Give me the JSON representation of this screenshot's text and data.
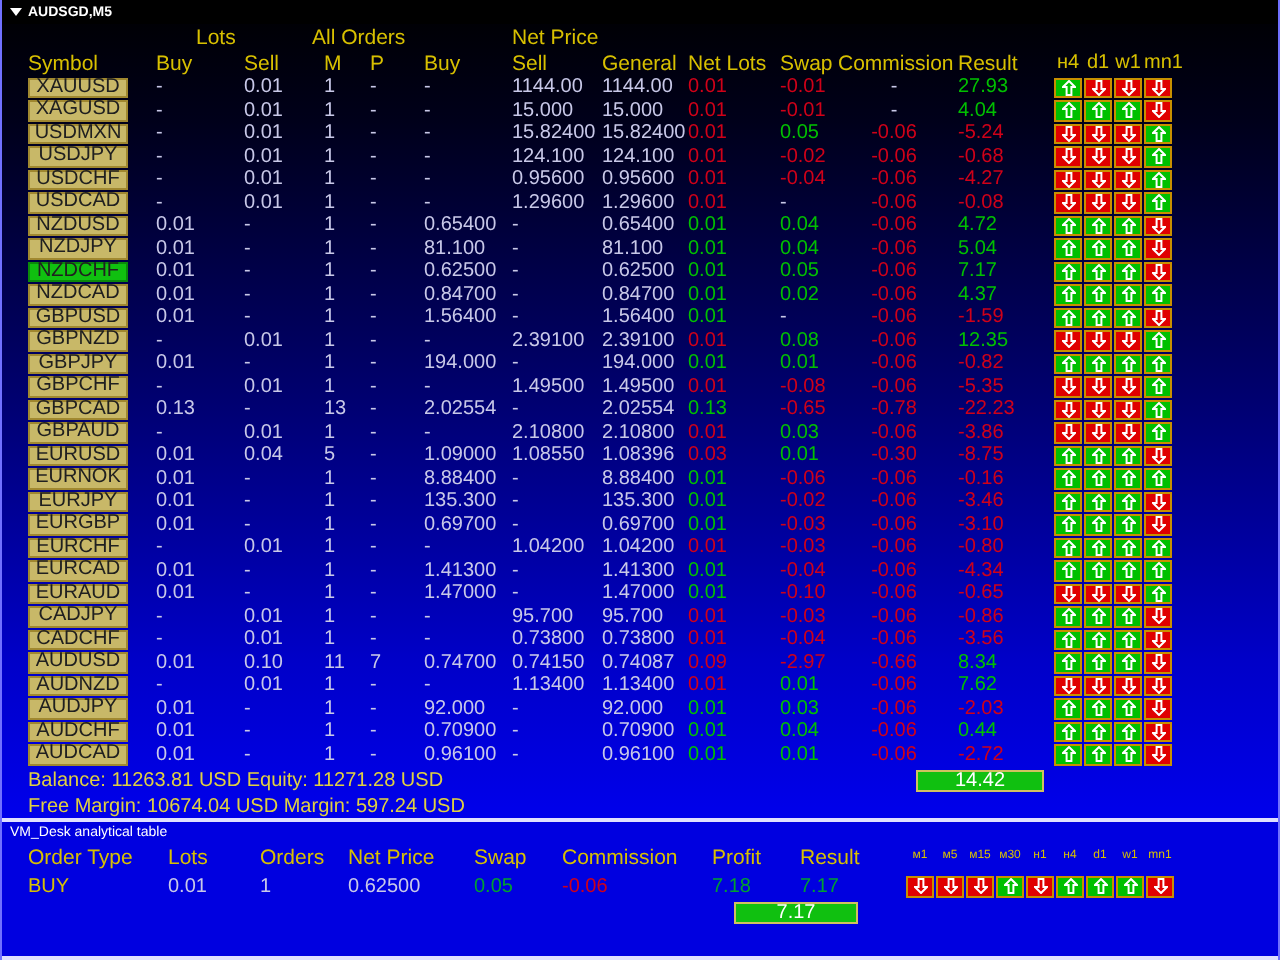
{
  "chart_title": "AUDSGD,M5",
  "group_headers": [
    "Lots",
    "All Orders",
    "Net Price"
  ],
  "columns": [
    "Symbol",
    "Buy",
    "Sell",
    "M",
    "P",
    "Buy",
    "Sell",
    "General",
    "Net Lots",
    "Swap",
    "Commission",
    "Result"
  ],
  "timeframes": [
    "н4",
    "d1",
    "w1",
    "mn1"
  ],
  "rows": [
    {
      "symbol": "XAUUSD",
      "selected": false,
      "buy_lots": "-",
      "sell_lots": "0.01",
      "m": "1",
      "p": "-",
      "buy_price": "-",
      "sell_price": "1144.00",
      "general": "1144.00",
      "net_lots": {
        "text": "0.01",
        "color": "#d00018"
      },
      "swap": {
        "text": "-0.01",
        "color": "#d00018"
      },
      "commission": {
        "text": "-",
        "color": "#c8c8e8"
      },
      "result": {
        "text": "27.93",
        "color": "#00c000"
      },
      "signals": [
        {
          "kind": "up"
        },
        {
          "kind": "down"
        },
        {
          "kind": "down"
        },
        {
          "kind": "down"
        }
      ]
    },
    {
      "symbol": "XAGUSD",
      "selected": false,
      "buy_lots": "-",
      "sell_lots": "0.01",
      "m": "1",
      "p": "-",
      "buy_price": "-",
      "sell_price": "15.000",
      "general": "15.000",
      "net_lots": {
        "text": "0.01",
        "color": "#d00018"
      },
      "swap": {
        "text": "-0.01",
        "color": "#d00018"
      },
      "commission": {
        "text": "-",
        "color": "#c8c8e8"
      },
      "result": {
        "text": "4.04",
        "color": "#00c000"
      },
      "signals": [
        {
          "kind": "up"
        },
        {
          "kind": "up"
        },
        {
          "kind": "up"
        },
        {
          "kind": "down"
        }
      ]
    },
    {
      "symbol": "USDMXN",
      "selected": false,
      "buy_lots": "-",
      "sell_lots": "0.01",
      "m": "1",
      "p": "-",
      "buy_price": "-",
      "sell_price": "15.82400",
      "general": "15.82400",
      "net_lots": {
        "text": "0.01",
        "color": "#d00018"
      },
      "swap": {
        "text": "0.05",
        "color": "#00c000"
      },
      "commission": {
        "text": "-0.06",
        "color": "#d00018"
      },
      "result": {
        "text": "-5.24",
        "color": "#d00018"
      },
      "signals": [
        {
          "kind": "down"
        },
        {
          "kind": "down"
        },
        {
          "kind": "down"
        },
        {
          "kind": "up"
        }
      ]
    },
    {
      "symbol": "USDJPY",
      "selected": false,
      "buy_lots": "-",
      "sell_lots": "0.01",
      "m": "1",
      "p": "-",
      "buy_price": "-",
      "sell_price": "124.100",
      "general": "124.100",
      "net_lots": {
        "text": "0.01",
        "color": "#d00018"
      },
      "swap": {
        "text": "-0.02",
        "color": "#d00018"
      },
      "commission": {
        "text": "-0.06",
        "color": "#d00018"
      },
      "result": {
        "text": "-0.68",
        "color": "#d00018"
      },
      "signals": [
        {
          "kind": "down"
        },
        {
          "kind": "down"
        },
        {
          "kind": "down"
        },
        {
          "kind": "up"
        }
      ]
    },
    {
      "symbol": "USDCHF",
      "selected": false,
      "buy_lots": "-",
      "sell_lots": "0.01",
      "m": "1",
      "p": "-",
      "buy_price": "-",
      "sell_price": "0.95600",
      "general": "0.95600",
      "net_lots": {
        "text": "0.01",
        "color": "#d00018"
      },
      "swap": {
        "text": "-0.04",
        "color": "#d00018"
      },
      "commission": {
        "text": "-0.06",
        "color": "#d00018"
      },
      "result": {
        "text": "-4.27",
        "color": "#d00018"
      },
      "signals": [
        {
          "kind": "down"
        },
        {
          "kind": "down"
        },
        {
          "kind": "down"
        },
        {
          "kind": "up"
        }
      ]
    },
    {
      "symbol": "USDCAD",
      "selected": false,
      "buy_lots": "-",
      "sell_lots": "0.01",
      "m": "1",
      "p": "-",
      "buy_price": "-",
      "sell_price": "1.29600",
      "general": "1.29600",
      "net_lots": {
        "text": "0.01",
        "color": "#d00018"
      },
      "swap": {
        "text": "-",
        "color": "#c8c8e8"
      },
      "commission": {
        "text": "-0.06",
        "color": "#d00018"
      },
      "result": {
        "text": "-0.08",
        "color": "#d00018"
      },
      "signals": [
        {
          "kind": "down"
        },
        {
          "kind": "down"
        },
        {
          "kind": "down"
        },
        {
          "kind": "up"
        }
      ]
    },
    {
      "symbol": "NZDUSD",
      "selected": false,
      "buy_lots": "0.01",
      "sell_lots": "-",
      "m": "1",
      "p": "-",
      "buy_price": "0.65400",
      "sell_price": "-",
      "general": "0.65400",
      "net_lots": {
        "text": "0.01",
        "color": "#00c000"
      },
      "swap": {
        "text": "0.04",
        "color": "#00c000"
      },
      "commission": {
        "text": "-0.06",
        "color": "#d00018"
      },
      "result": {
        "text": "4.72",
        "color": "#00c000"
      },
      "signals": [
        {
          "kind": "up"
        },
        {
          "kind": "up"
        },
        {
          "kind": "up"
        },
        {
          "kind": "down"
        }
      ]
    },
    {
      "symbol": "NZDJPY",
      "selected": false,
      "buy_lots": "0.01",
      "sell_lots": "-",
      "m": "1",
      "p": "-",
      "buy_price": "81.100",
      "sell_price": "-",
      "general": "81.100",
      "net_lots": {
        "text": "0.01",
        "color": "#00c000"
      },
      "swap": {
        "text": "0.04",
        "color": "#00c000"
      },
      "commission": {
        "text": "-0.06",
        "color": "#d00018"
      },
      "result": {
        "text": "5.04",
        "color": "#00c000"
      },
      "signals": [
        {
          "kind": "up"
        },
        {
          "kind": "up"
        },
        {
          "kind": "up"
        },
        {
          "kind": "down"
        }
      ]
    },
    {
      "symbol": "NZDCHF",
      "selected": true,
      "buy_lots": "0.01",
      "sell_lots": "-",
      "m": "1",
      "p": "-",
      "buy_price": "0.62500",
      "sell_price": "-",
      "general": "0.62500",
      "net_lots": {
        "text": "0.01",
        "color": "#00c000"
      },
      "swap": {
        "text": "0.05",
        "color": "#00c000"
      },
      "commission": {
        "text": "-0.06",
        "color": "#d00018"
      },
      "result": {
        "text": "7.17",
        "color": "#00c000"
      },
      "signals": [
        {
          "kind": "up"
        },
        {
          "kind": "up"
        },
        {
          "kind": "up"
        },
        {
          "kind": "down"
        }
      ]
    },
    {
      "symbol": "NZDCAD",
      "selected": false,
      "buy_lots": "0.01",
      "sell_lots": "-",
      "m": "1",
      "p": "-",
      "buy_price": "0.84700",
      "sell_price": "-",
      "general": "0.84700",
      "net_lots": {
        "text": "0.01",
        "color": "#00c000"
      },
      "swap": {
        "text": "0.02",
        "color": "#00c000"
      },
      "commission": {
        "text": "-0.06",
        "color": "#d00018"
      },
      "result": {
        "text": "4.37",
        "color": "#00c000"
      },
      "signals": [
        {
          "kind": "up"
        },
        {
          "kind": "up"
        },
        {
          "kind": "up"
        },
        {
          "kind": "up"
        }
      ]
    },
    {
      "symbol": "GBPUSD",
      "selected": false,
      "buy_lots": "0.01",
      "sell_lots": "-",
      "m": "1",
      "p": "-",
      "buy_price": "1.56400",
      "sell_price": "-",
      "general": "1.56400",
      "net_lots": {
        "text": "0.01",
        "color": "#00c000"
      },
      "swap": {
        "text": "-",
        "color": "#c8c8e8"
      },
      "commission": {
        "text": "-0.06",
        "color": "#d00018"
      },
      "result": {
        "text": "-1.59",
        "color": "#d00018"
      },
      "signals": [
        {
          "kind": "up"
        },
        {
          "kind": "up"
        },
        {
          "kind": "up"
        },
        {
          "kind": "down"
        }
      ]
    },
    {
      "symbol": "GBPNZD",
      "selected": false,
      "buy_lots": "-",
      "sell_lots": "0.01",
      "m": "1",
      "p": "-",
      "buy_price": "-",
      "sell_price": "2.39100",
      "general": "2.39100",
      "net_lots": {
        "text": "0.01",
        "color": "#d00018"
      },
      "swap": {
        "text": "0.08",
        "color": "#00c000"
      },
      "commission": {
        "text": "-0.06",
        "color": "#d00018"
      },
      "result": {
        "text": "12.35",
        "color": "#00c000"
      },
      "signals": [
        {
          "kind": "down"
        },
        {
          "kind": "down"
        },
        {
          "kind": "down"
        },
        {
          "kind": "up"
        }
      ]
    },
    {
      "symbol": "GBPJPY",
      "selected": false,
      "buy_lots": "0.01",
      "sell_lots": "-",
      "m": "1",
      "p": "-",
      "buy_price": "194.000",
      "sell_price": "-",
      "general": "194.000",
      "net_lots": {
        "text": "0.01",
        "color": "#00c000"
      },
      "swap": {
        "text": "0.01",
        "color": "#00c000"
      },
      "commission": {
        "text": "-0.06",
        "color": "#d00018"
      },
      "result": {
        "text": "-0.82",
        "color": "#d00018"
      },
      "signals": [
        {
          "kind": "up"
        },
        {
          "kind": "up"
        },
        {
          "kind": "up"
        },
        {
          "kind": "up"
        }
      ]
    },
    {
      "symbol": "GBPCHF",
      "selected": false,
      "buy_lots": "-",
      "sell_lots": "0.01",
      "m": "1",
      "p": "-",
      "buy_price": "-",
      "sell_price": "1.49500",
      "general": "1.49500",
      "net_lots": {
        "text": "0.01",
        "color": "#d00018"
      },
      "swap": {
        "text": "-0.08",
        "color": "#d00018"
      },
      "commission": {
        "text": "-0.06",
        "color": "#d00018"
      },
      "result": {
        "text": "-5.35",
        "color": "#d00018"
      },
      "signals": [
        {
          "kind": "down"
        },
        {
          "kind": "down"
        },
        {
          "kind": "down"
        },
        {
          "kind": "up"
        }
      ]
    },
    {
      "symbol": "GBPCAD",
      "selected": false,
      "buy_lots": "0.13",
      "sell_lots": "-",
      "m": "13",
      "p": "-",
      "buy_price": "2.02554",
      "sell_price": "-",
      "general": "2.02554",
      "net_lots": {
        "text": "0.13",
        "color": "#00c000"
      },
      "swap": {
        "text": "-0.65",
        "color": "#d00018"
      },
      "commission": {
        "text": "-0.78",
        "color": "#d00018"
      },
      "result": {
        "text": "-22.23",
        "color": "#d00018"
      },
      "signals": [
        {
          "kind": "down"
        },
        {
          "kind": "down"
        },
        {
          "kind": "down"
        },
        {
          "kind": "up"
        }
      ]
    },
    {
      "symbol": "GBPAUD",
      "selected": false,
      "buy_lots": "-",
      "sell_lots": "0.01",
      "m": "1",
      "p": "-",
      "buy_price": "-",
      "sell_price": "2.10800",
      "general": "2.10800",
      "net_lots": {
        "text": "0.01",
        "color": "#d00018"
      },
      "swap": {
        "text": "0.03",
        "color": "#00c000"
      },
      "commission": {
        "text": "-0.06",
        "color": "#d00018"
      },
      "result": {
        "text": "-3.86",
        "color": "#d00018"
      },
      "signals": [
        {
          "kind": "down"
        },
        {
          "kind": "down"
        },
        {
          "kind": "down"
        },
        {
          "kind": "up"
        }
      ]
    },
    {
      "symbol": "EURUSD",
      "selected": false,
      "buy_lots": "0.01",
      "sell_lots": "0.04",
      "m": "5",
      "p": "-",
      "buy_price": "1.09000",
      "sell_price": "1.08550",
      "general": "1.08396",
      "net_lots": {
        "text": "0.03",
        "color": "#d00018"
      },
      "swap": {
        "text": "0.01",
        "color": "#00c000"
      },
      "commission": {
        "text": "-0.30",
        "color": "#d00018"
      },
      "result": {
        "text": "-8.75",
        "color": "#d00018"
      },
      "signals": [
        {
          "kind": "up"
        },
        {
          "kind": "up"
        },
        {
          "kind": "up"
        },
        {
          "kind": "down"
        }
      ]
    },
    {
      "symbol": "EURNOK",
      "selected": false,
      "buy_lots": "0.01",
      "sell_lots": "-",
      "m": "1",
      "p": "-",
      "buy_price": "8.88400",
      "sell_price": "-",
      "general": "8.88400",
      "net_lots": {
        "text": "0.01",
        "color": "#00c000"
      },
      "swap": {
        "text": "-0.06",
        "color": "#d00018"
      },
      "commission": {
        "text": "-0.06",
        "color": "#d00018"
      },
      "result": {
        "text": "-0.16",
        "color": "#d00018"
      },
      "signals": [
        {
          "kind": "up"
        },
        {
          "kind": "up"
        },
        {
          "kind": "up"
        },
        {
          "kind": "up"
        }
      ]
    },
    {
      "symbol": "EURJPY",
      "selected": false,
      "buy_lots": "0.01",
      "sell_lots": "-",
      "m": "1",
      "p": "-",
      "buy_price": "135.300",
      "sell_price": "-",
      "general": "135.300",
      "net_lots": {
        "text": "0.01",
        "color": "#00c000"
      },
      "swap": {
        "text": "-0.02",
        "color": "#d00018"
      },
      "commission": {
        "text": "-0.06",
        "color": "#d00018"
      },
      "result": {
        "text": "-3.46",
        "color": "#d00018"
      },
      "signals": [
        {
          "kind": "up"
        },
        {
          "kind": "up"
        },
        {
          "kind": "up"
        },
        {
          "kind": "down"
        }
      ]
    },
    {
      "symbol": "EURGBP",
      "selected": false,
      "buy_lots": "0.01",
      "sell_lots": "-",
      "m": "1",
      "p": "-",
      "buy_price": "0.69700",
      "sell_price": "-",
      "general": "0.69700",
      "net_lots": {
        "text": "0.01",
        "color": "#00c000"
      },
      "swap": {
        "text": "-0.03",
        "color": "#d00018"
      },
      "commission": {
        "text": "-0.06",
        "color": "#d00018"
      },
      "result": {
        "text": "-3.10",
        "color": "#d00018"
      },
      "signals": [
        {
          "kind": "up"
        },
        {
          "kind": "up"
        },
        {
          "kind": "up"
        },
        {
          "kind": "down"
        }
      ]
    },
    {
      "symbol": "EURCHF",
      "selected": false,
      "buy_lots": "-",
      "sell_lots": "0.01",
      "m": "1",
      "p": "-",
      "buy_price": "-",
      "sell_price": "1.04200",
      "general": "1.04200",
      "net_lots": {
        "text": "0.01",
        "color": "#d00018"
      },
      "swap": {
        "text": "-0.03",
        "color": "#d00018"
      },
      "commission": {
        "text": "-0.06",
        "color": "#d00018"
      },
      "result": {
        "text": "-0.80",
        "color": "#d00018"
      },
      "signals": [
        {
          "kind": "up"
        },
        {
          "kind": "up"
        },
        {
          "kind": "up"
        },
        {
          "kind": "up"
        }
      ]
    },
    {
      "symbol": "EURCAD",
      "selected": false,
      "buy_lots": "0.01",
      "sell_lots": "-",
      "m": "1",
      "p": "-",
      "buy_price": "1.41300",
      "sell_price": "-",
      "general": "1.41300",
      "net_lots": {
        "text": "0.01",
        "color": "#00c000"
      },
      "swap": {
        "text": "-0.04",
        "color": "#d00018"
      },
      "commission": {
        "text": "-0.06",
        "color": "#d00018"
      },
      "result": {
        "text": "-4.34",
        "color": "#d00018"
      },
      "signals": [
        {
          "kind": "up"
        },
        {
          "kind": "up"
        },
        {
          "kind": "up"
        },
        {
          "kind": "up"
        }
      ]
    },
    {
      "symbol": "EURAUD",
      "selected": false,
      "buy_lots": "0.01",
      "sell_lots": "-",
      "m": "1",
      "p": "-",
      "buy_price": "1.47000",
      "sell_price": "-",
      "general": "1.47000",
      "net_lots": {
        "text": "0.01",
        "color": "#00c000"
      },
      "swap": {
        "text": "-0.10",
        "color": "#d00018"
      },
      "commission": {
        "text": "-0.06",
        "color": "#d00018"
      },
      "result": {
        "text": "-0.65",
        "color": "#d00018"
      },
      "signals": [
        {
          "kind": "down"
        },
        {
          "kind": "down"
        },
        {
          "kind": "down"
        },
        {
          "kind": "up"
        }
      ]
    },
    {
      "symbol": "CADJPY",
      "selected": false,
      "buy_lots": "-",
      "sell_lots": "0.01",
      "m": "1",
      "p": "-",
      "buy_price": "-",
      "sell_price": "95.700",
      "general": "95.700",
      "net_lots": {
        "text": "0.01",
        "color": "#d00018"
      },
      "swap": {
        "text": "-0.03",
        "color": "#d00018"
      },
      "commission": {
        "text": "-0.06",
        "color": "#d00018"
      },
      "result": {
        "text": "-0.86",
        "color": "#d00018"
      },
      "signals": [
        {
          "kind": "up"
        },
        {
          "kind": "up"
        },
        {
          "kind": "up"
        },
        {
          "kind": "down"
        }
      ]
    },
    {
      "symbol": "CADCHF",
      "selected": false,
      "buy_lots": "-",
      "sell_lots": "0.01",
      "m": "1",
      "p": "-",
      "buy_price": "-",
      "sell_price": "0.73800",
      "general": "0.73800",
      "net_lots": {
        "text": "0.01",
        "color": "#d00018"
      },
      "swap": {
        "text": "-0.04",
        "color": "#d00018"
      },
      "commission": {
        "text": "-0.06",
        "color": "#d00018"
      },
      "result": {
        "text": "-3.56",
        "color": "#d00018"
      },
      "signals": [
        {
          "kind": "up"
        },
        {
          "kind": "up"
        },
        {
          "kind": "up"
        },
        {
          "kind": "down"
        }
      ]
    },
    {
      "symbol": "AUDUSD",
      "selected": false,
      "buy_lots": "0.01",
      "sell_lots": "0.10",
      "m": "11",
      "p": "7",
      "buy_price": "0.74700",
      "sell_price": "0.74150",
      "general": "0.74087",
      "net_lots": {
        "text": "0.09",
        "color": "#d00018"
      },
      "swap": {
        "text": "-2.97",
        "color": "#d00018"
      },
      "commission": {
        "text": "-0.66",
        "color": "#d00018"
      },
      "result": {
        "text": "8.34",
        "color": "#00c000"
      },
      "signals": [
        {
          "kind": "up"
        },
        {
          "kind": "up"
        },
        {
          "kind": "up"
        },
        {
          "kind": "down"
        }
      ]
    },
    {
      "symbol": "AUDNZD",
      "selected": false,
      "buy_lots": "-",
      "sell_lots": "0.01",
      "m": "1",
      "p": "-",
      "buy_price": "-",
      "sell_price": "1.13400",
      "general": "1.13400",
      "net_lots": {
        "text": "0.01",
        "color": "#d00018"
      },
      "swap": {
        "text": "0.01",
        "color": "#00c000"
      },
      "commission": {
        "text": "-0.06",
        "color": "#d00018"
      },
      "result": {
        "text": "7.62",
        "color": "#00c000"
      },
      "signals": [
        {
          "kind": "down"
        },
        {
          "kind": "down"
        },
        {
          "kind": "down"
        },
        {
          "kind": "down"
        }
      ]
    },
    {
      "symbol": "AUDJPY",
      "selected": false,
      "buy_lots": "0.01",
      "sell_lots": "-",
      "m": "1",
      "p": "-",
      "buy_price": "92.000",
      "sell_price": "-",
      "general": "92.000",
      "net_lots": {
        "text": "0.01",
        "color": "#00c000"
      },
      "swap": {
        "text": "0.03",
        "color": "#00c000"
      },
      "commission": {
        "text": "-0.06",
        "color": "#d00018"
      },
      "result": {
        "text": "-2.03",
        "color": "#d00018"
      },
      "signals": [
        {
          "kind": "up"
        },
        {
          "kind": "up"
        },
        {
          "kind": "up"
        },
        {
          "kind": "down"
        }
      ]
    },
    {
      "symbol": "AUDCHF",
      "selected": false,
      "buy_lots": "0.01",
      "sell_lots": "-",
      "m": "1",
      "p": "-",
      "buy_price": "0.70900",
      "sell_price": "-",
      "general": "0.70900",
      "net_lots": {
        "text": "0.01",
        "color": "#00c000"
      },
      "swap": {
        "text": "0.04",
        "color": "#00c000"
      },
      "commission": {
        "text": "-0.06",
        "color": "#d00018"
      },
      "result": {
        "text": "0.44",
        "color": "#00c000"
      },
      "signals": [
        {
          "kind": "up"
        },
        {
          "kind": "up"
        },
        {
          "kind": "up"
        },
        {
          "kind": "down"
        }
      ]
    },
    {
      "symbol": "AUDCAD",
      "selected": false,
      "buy_lots": "0.01",
      "sell_lots": "-",
      "m": "1",
      "p": "-",
      "buy_price": "0.96100",
      "sell_price": "-",
      "general": "0.96100",
      "net_lots": {
        "text": "0.01",
        "color": "#00c000"
      },
      "swap": {
        "text": "0.01",
        "color": "#00c000"
      },
      "commission": {
        "text": "-0.06",
        "color": "#d00018"
      },
      "result": {
        "text": "-2.72",
        "color": "#d00018"
      },
      "signals": [
        {
          "kind": "up"
        },
        {
          "kind": "up"
        },
        {
          "kind": "up"
        },
        {
          "kind": "down"
        }
      ]
    }
  ],
  "account": {
    "lines": [
      "Balance: 11263.81 USD Equity: 11271.28 USD",
      "Free Margin: 10674.04 USD Margin: 597.24 USD"
    ],
    "total": "14.42"
  },
  "analytics": {
    "title": "VM_Desk analytical table",
    "columns": [
      "Order Type",
      "Lots",
      "Orders",
      "Net Price",
      "Swap",
      "Commission",
      "Profit",
      "Result"
    ],
    "row": {
      "order_type": "BUY",
      "lots": "0.01",
      "orders": "1",
      "net_price": "0.62500",
      "swap": {
        "text": "0.05",
        "color": "#00a030"
      },
      "commission": {
        "text": "-0.06",
        "color": "#d00018"
      },
      "profit": {
        "text": "7.18",
        "color": "#00a030"
      },
      "result": {
        "text": "7.17",
        "color": "#00a030"
      }
    },
    "timeframes": [
      "м1",
      "м5",
      "м15",
      "м30",
      "н1",
      "н4",
      "d1",
      "w1",
      "mn1"
    ],
    "signals": [
      {
        "kind": "down"
      },
      {
        "kind": "down"
      },
      {
        "kind": "down"
      },
      {
        "kind": "up"
      },
      {
        "kind": "down"
      },
      {
        "kind": "up"
      },
      {
        "kind": "up"
      },
      {
        "kind": "up"
      },
      {
        "kind": "down"
      }
    ],
    "total": "7.17"
  }
}
